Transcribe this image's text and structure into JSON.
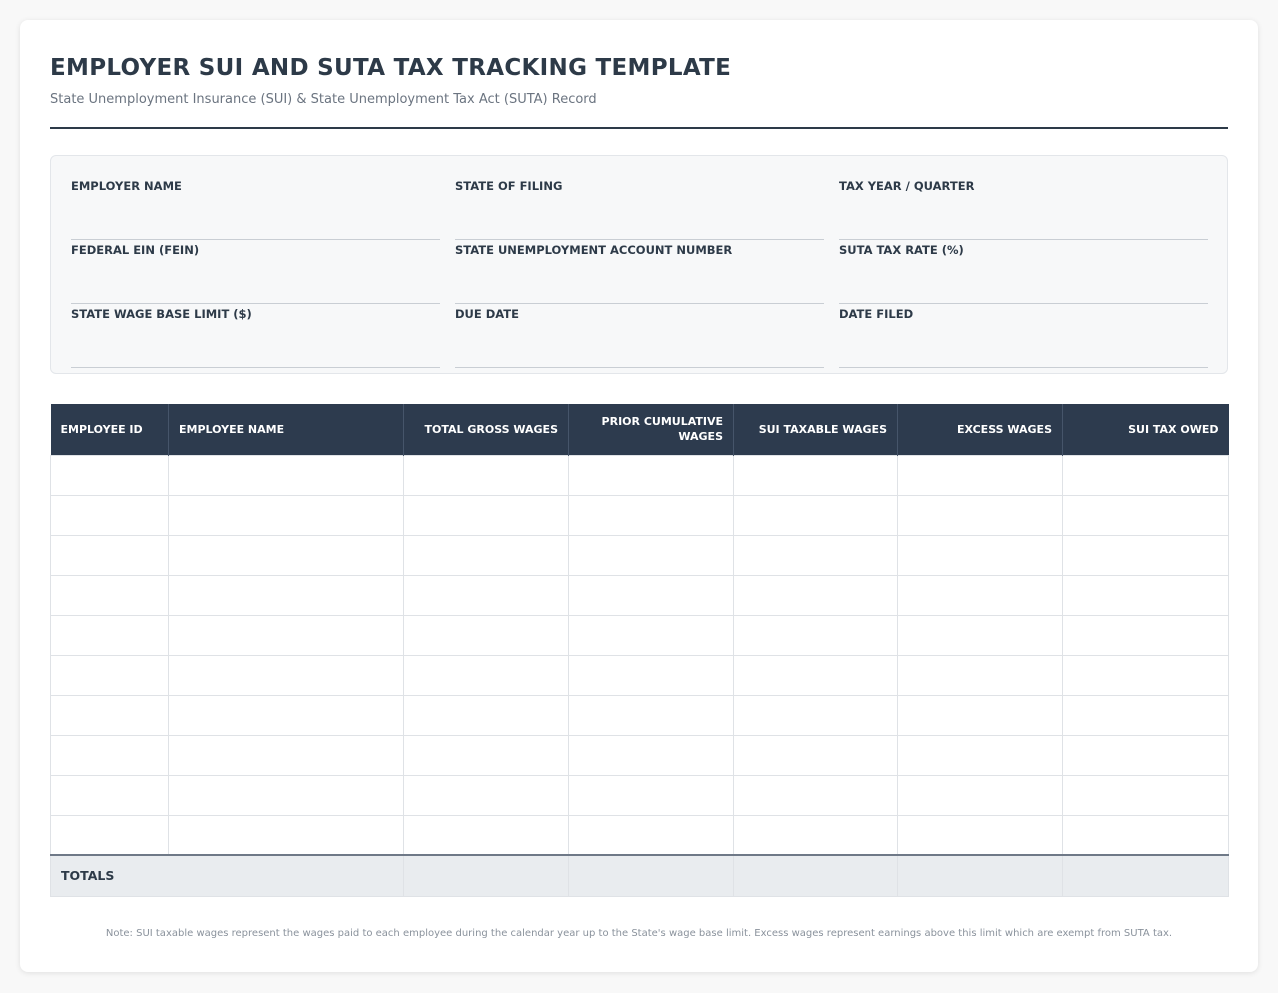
{
  "header": {
    "title": "EMPLOYER SUI AND SUTA TAX TRACKING TEMPLATE",
    "subtitle": "State Unemployment Insurance (SUI) & State Unemployment Tax Act (SUTA) Record"
  },
  "employer_info": {
    "fields": [
      {
        "label": "EMPLOYER NAME",
        "value": ""
      },
      {
        "label": "STATE OF FILING",
        "value": ""
      },
      {
        "label": "TAX YEAR / QUARTER",
        "value": ""
      },
      {
        "label": "FEDERAL EIN (FEIN)",
        "value": ""
      },
      {
        "label": "STATE UNEMPLOYMENT ACCOUNT NUMBER",
        "value": ""
      },
      {
        "label": "SUTA TAX RATE (%)",
        "value": ""
      },
      {
        "label": "STATE WAGE BASE LIMIT ($)",
        "value": ""
      },
      {
        "label": "DUE DATE",
        "value": ""
      },
      {
        "label": "DATE FILED",
        "value": ""
      }
    ]
  },
  "table": {
    "columns": [
      "EMPLOYEE ID",
      "EMPLOYEE NAME",
      "TOTAL GROSS WAGES",
      "PRIOR CUMULATIVE WAGES",
      "SUI TAXABLE WAGES",
      "EXCESS WAGES",
      "SUI TAX OWED"
    ],
    "rows": [
      [
        "",
        "",
        "",
        "",
        "",
        "",
        ""
      ],
      [
        "",
        "",
        "",
        "",
        "",
        "",
        ""
      ],
      [
        "",
        "",
        "",
        "",
        "",
        "",
        ""
      ],
      [
        "",
        "",
        "",
        "",
        "",
        "",
        ""
      ],
      [
        "",
        "",
        "",
        "",
        "",
        "",
        ""
      ],
      [
        "",
        "",
        "",
        "",
        "",
        "",
        ""
      ],
      [
        "",
        "",
        "",
        "",
        "",
        "",
        ""
      ],
      [
        "",
        "",
        "",
        "",
        "",
        "",
        ""
      ],
      [
        "",
        "",
        "",
        "",
        "",
        "",
        ""
      ],
      [
        "",
        "",
        "",
        "",
        "",
        "",
        ""
      ]
    ],
    "totals": {
      "label": "TOTALS",
      "values": [
        "",
        "",
        "",
        "",
        ""
      ]
    }
  },
  "footer": {
    "note": "Note: SUI taxable wages represent the wages paid to each employee during the calendar year up to the State's wage base limit. Excess wages represent earnings above this limit which are exempt from SUTA tax."
  },
  "colors": {
    "primary_dark": "#2d3b4e",
    "panel_bg": "#f7f8f9",
    "totals_bg": "#e9ecef",
    "muted_text": "#6b7480"
  }
}
